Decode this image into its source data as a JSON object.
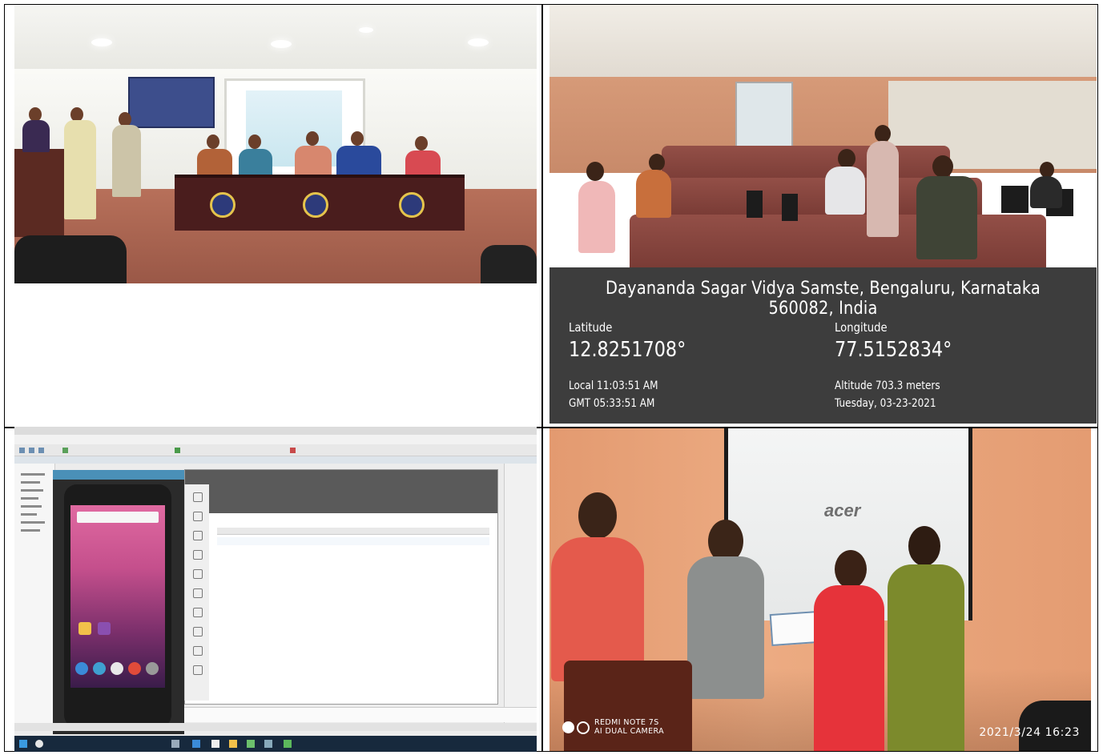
{
  "photos": {
    "lab_geotag": {
      "address": "Dayananda Sagar Vidya Samste, Bengaluru, Karnataka 560082, India",
      "latitude_label": "Latitude",
      "latitude_value": "12.8251708°",
      "longitude_label": "Longitude",
      "longitude_value": "77.5152834°",
      "local_time": "Local 11:03:51 AM",
      "gmt_time": "GMT 05:33:51 AM",
      "altitude": "Altitude 703.3 meters",
      "date": "Tuesday, 03-23-2021"
    },
    "presentation": {
      "screen_brand": "acer",
      "camera_line1": "REDMI NOTE 7S",
      "camera_line2": "AI DUAL CAMERA",
      "timestamp": "2021/3/24  16:23"
    }
  },
  "colors": {
    "overlay": "#121212",
    "stage_floor": "#a65f4c",
    "lab_wall": "#d69a78",
    "presentation_wall": "#e9a47b",
    "taskbar": "#17293d"
  }
}
